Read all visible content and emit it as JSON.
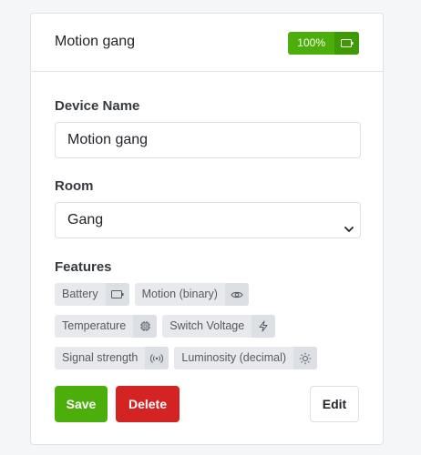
{
  "card": {
    "title": "Motion gang",
    "battery": {
      "label": "100%",
      "icon": "battery-icon",
      "color": "#4cae0a"
    }
  },
  "form": {
    "device_name_label": "Device Name",
    "device_name_value": "Motion gang",
    "room_label": "Room",
    "room_value": "Gang",
    "features_label": "Features"
  },
  "features": [
    {
      "label": "Battery",
      "icon": "battery-icon"
    },
    {
      "label": "Motion (binary)",
      "icon": "eye-icon"
    },
    {
      "label": "Temperature",
      "icon": "chip-icon"
    },
    {
      "label": "Switch Voltage",
      "icon": "bolt-icon"
    },
    {
      "label": "Signal strength",
      "icon": "signal-icon"
    },
    {
      "label": "Luminosity (decimal)",
      "icon": "sun-icon"
    }
  ],
  "actions": {
    "save_label": "Save",
    "delete_label": "Delete",
    "edit_label": "Edit"
  },
  "colors": {
    "save": "#4cae0a",
    "delete": "#d32323"
  }
}
